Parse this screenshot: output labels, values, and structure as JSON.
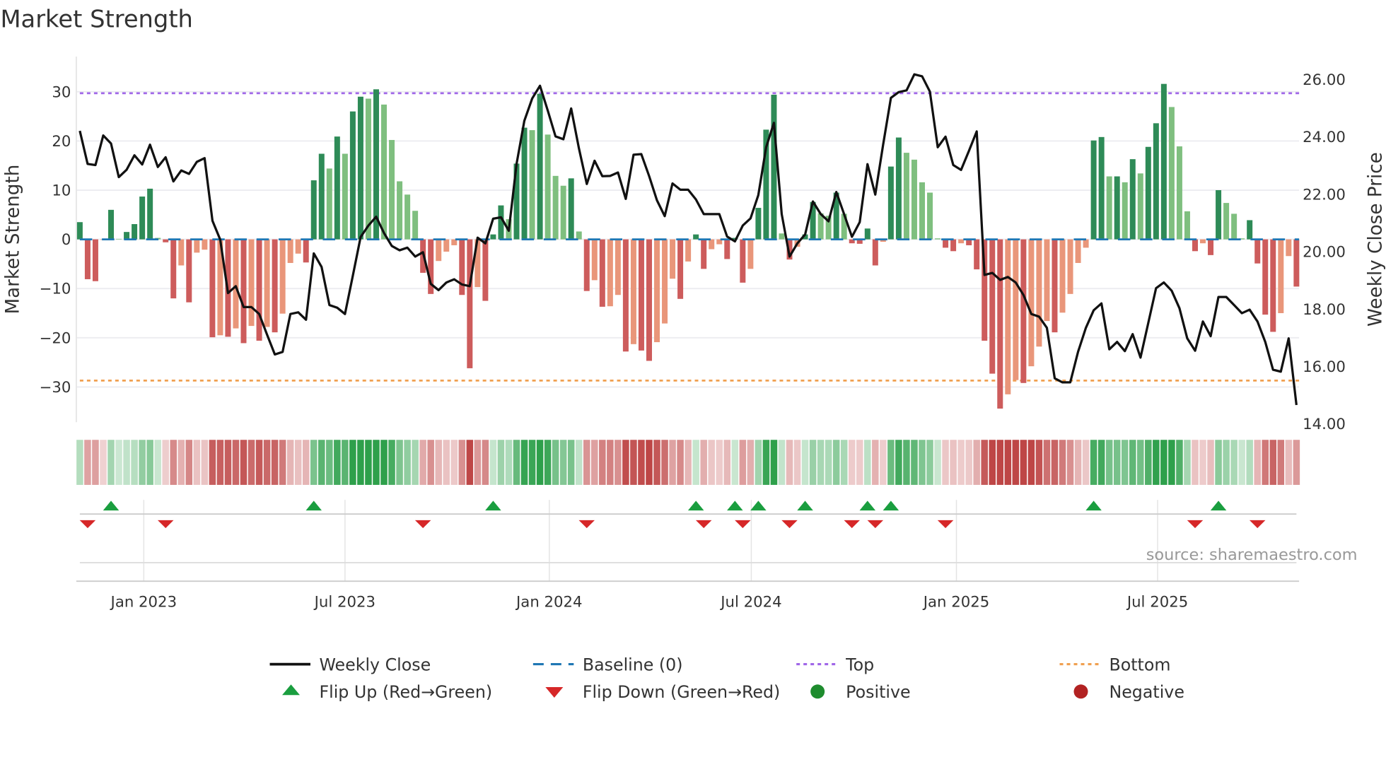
{
  "chart_data": {
    "type": "bar",
    "title": "Market Strength",
    "ylabel": "Market Strength",
    "y2label": "Weekly Close Price",
    "ylim": [
      -37,
      37
    ],
    "y2lim": [
      14,
      26.6
    ],
    "yticks": [
      "30",
      "20",
      "10",
      "0",
      "−10",
      "−20",
      "−30"
    ],
    "ytick_values": [
      30,
      20,
      10,
      0,
      -10,
      -20,
      -30
    ],
    "y2ticks": [
      "26.00",
      "24.00",
      "22.00",
      "20.00",
      "18.00",
      "16.00",
      "14.00"
    ],
    "y2tick_values": [
      26,
      24,
      22,
      20,
      18,
      16,
      14
    ],
    "xticks": [
      {
        "label": "Jan 2023",
        "week": 8.2
      },
      {
        "label": "Jul 2023",
        "week": 34
      },
      {
        "label": "Jan 2024",
        "week": 60.2
      },
      {
        "label": "Jul 2024",
        "week": 86.1
      },
      {
        "label": "Jan 2025",
        "week": 112.4
      },
      {
        "label": "Jul 2025",
        "week": 138.2
      }
    ],
    "top_level": 29.7,
    "bottom_level": -28.7,
    "baseline": 0,
    "strength": [
      3.5,
      -8.1,
      -8.5,
      -0.1,
      6,
      0.1,
      1.5,
      3.1,
      8.7,
      10.3,
      0.3,
      -0.6,
      -12,
      -5.3,
      -12.8,
      -2.7,
      -2.1,
      -19.9,
      -19.5,
      -19.8,
      -18.1,
      -21.1,
      -17.6,
      -20.6,
      -17.8,
      -18.9,
      -15.1,
      -4.8,
      -2.9,
      -4.7,
      12,
      17.4,
      14.4,
      20.9,
      17.4,
      26,
      29,
      28.6,
      30.5,
      27.4,
      20.2,
      11.8,
      9.1,
      5.8,
      -6.8,
      -11.1,
      -4.4,
      -2.5,
      -1.2,
      -11.3,
      -26.2,
      -9.7,
      -12.5,
      1,
      6.9,
      4.1,
      15.4,
      22.7,
      22.2,
      29.6,
      21.3,
      12.9,
      10.9,
      12.4,
      1.6,
      -10.5,
      -8.3,
      -13.7,
      -13.6,
      -11.3,
      -22.8,
      -21.3,
      -22.6,
      -24.7,
      -20.9,
      -17.1,
      -8,
      -12.1,
      -4.5,
      1,
      -6,
      -2,
      -1,
      -4,
      0.3,
      -8.8,
      -6,
      6.4,
      22.3,
      29.4,
      1.2,
      -4.1,
      -1.5,
      1,
      7.6,
      5.3,
      4.8,
      9.5,
      5.2,
      -0.8,
      -0.9,
      2.2,
      -5.3,
      -0.5,
      14.8,
      20.7,
      17.6,
      16.2,
      11.6,
      9.5,
      0.2,
      -1.7,
      -2.4,
      -0.8,
      -1.2,
      -6.1,
      -20.6,
      -27.3,
      -34.4,
      -31.5,
      -28.6,
      -29.2,
      -25.8,
      -21.8,
      -16.6,
      -18.9,
      -14.9,
      -11.1,
      -4.8,
      -1.7,
      20.1,
      20.8,
      12.8,
      12.8,
      11.6,
      16.3,
      13.4,
      18.8,
      23.6,
      31.6,
      26.9,
      18.9,
      5.7,
      -2.4,
      -0.8,
      -3.2,
      10,
      7.4,
      5.2,
      0.2,
      3.9,
      -4.9,
      -15.3,
      -18.8,
      -15,
      -3.4,
      -9.6
    ],
    "weekly_close": [
      24.21,
      23.06,
      23.02,
      24.05,
      23.77,
      22.6,
      22.86,
      23.36,
      23.04,
      23.73,
      22.95,
      23.29,
      22.45,
      22.83,
      22.71,
      23.13,
      23.26,
      21.08,
      20.42,
      18.56,
      18.8,
      18.07,
      18.07,
      17.83,
      17.12,
      16.42,
      16.51,
      17.83,
      17.89,
      17.63,
      19.94,
      19.47,
      18.14,
      18.05,
      17.83,
      19.15,
      20.51,
      20.91,
      21.22,
      20.65,
      20.2,
      20.05,
      20.14,
      19.83,
      19.98,
      18.88,
      18.66,
      18.93,
      19.04,
      18.86,
      18.8,
      20.49,
      20.29,
      21.15,
      21.2,
      20.73,
      23.06,
      24.56,
      25.34,
      25.78,
      24.92,
      24.02,
      23.92,
      24.99,
      23.6,
      22.36,
      23.17,
      22.63,
      22.64,
      22.76,
      21.84,
      23.38,
      23.4,
      22.63,
      21.79,
      21.24,
      22.38,
      22.16,
      22.16,
      21.82,
      21.31,
      21.31,
      21.31,
      20.53,
      20.36,
      20.91,
      21.16,
      21.97,
      23.64,
      24.49,
      21.31,
      19.83,
      20.29,
      20.6,
      21.75,
      21.31,
      21.06,
      22.08,
      21.31,
      20.52,
      21.03,
      23.05,
      21.99,
      23.73,
      25.36,
      25.56,
      25.62,
      26.18,
      26.11,
      25.58,
      23.64,
      24.01,
      23.02,
      22.85,
      23.51,
      24.19,
      19.19,
      19.26,
      19.02,
      19.12,
      18.93,
      18.49,
      17.83,
      17.74,
      17.35,
      15.59,
      15.45,
      15.45,
      16.51,
      17.35,
      17.96,
      18.2,
      16.6,
      16.86,
      16.54,
      17.13,
      16.31,
      17.52,
      18.73,
      18.93,
      18.64,
      18.03,
      16.98,
      16.55,
      17.57,
      17.06,
      18.42,
      18.42,
      18.14,
      17.86,
      17.98,
      17.57,
      16.86,
      15.89,
      15.82,
      16.98,
      14.66
    ],
    "legend": [
      {
        "label": "Weekly Close",
        "icon": "solid-line"
      },
      {
        "label": "Baseline (0)",
        "icon": "dashed-line"
      },
      {
        "label": "Top",
        "icon": "dotted-line"
      },
      {
        "label": "Bottom",
        "icon": "dotted-line"
      },
      {
        "label": "Flip Up (Red→Green)",
        "icon": "up-triangle"
      },
      {
        "label": "Flip Down (Green→Red)",
        "icon": "down-triangle"
      },
      {
        "label": "Positive",
        "icon": "circle"
      },
      {
        "label": "Negative",
        "icon": "circle"
      }
    ],
    "legend_placement": "bottom",
    "grid": true
  },
  "source": "source: sharemaestro.com",
  "colors": {
    "strong_positive": "#2e8b57",
    "weak_positive": "#7fbf7f",
    "strong_negative": "#cd5c5c",
    "weak_negative": "#e9967a",
    "price_line": "#111111",
    "baseline": "#1f77b4",
    "top": "#a066e8",
    "bottom": "#f0a050",
    "flip_up": "#1a9e3f",
    "flip_down": "#d62728",
    "positive_dot": "#1e8c2e",
    "negative_dot": "#b22222"
  }
}
